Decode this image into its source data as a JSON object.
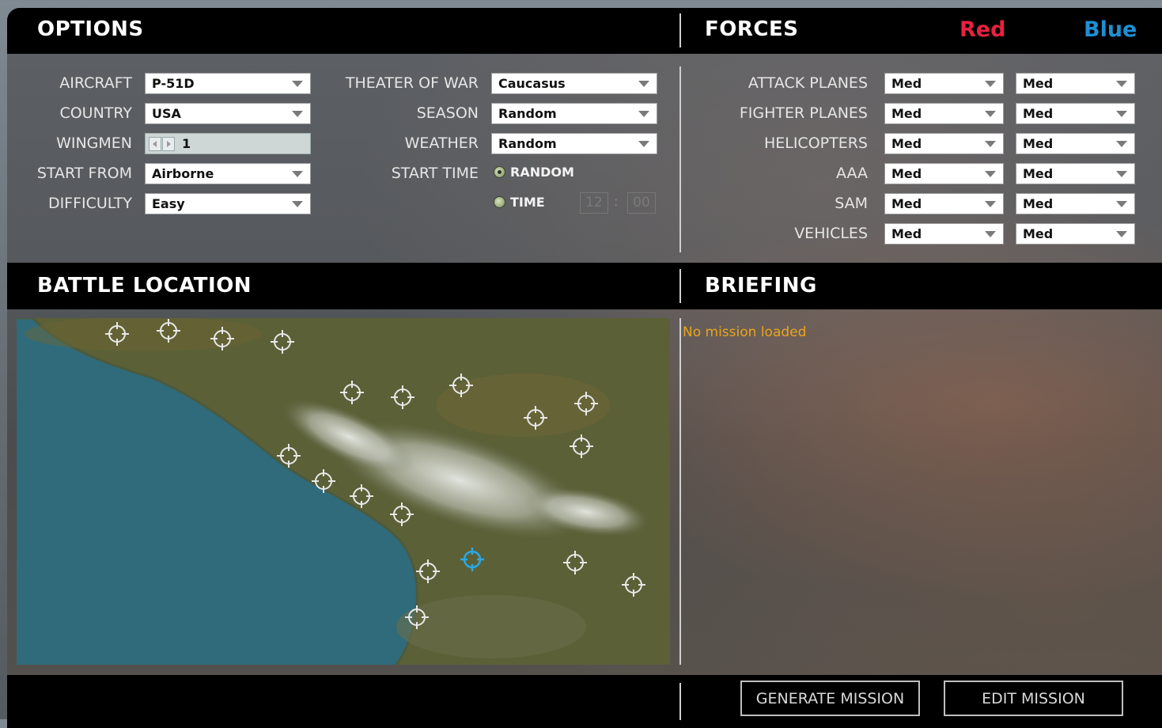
{
  "options": {
    "title": "OPTIONS",
    "aircraft": {
      "label": "AIRCRAFT",
      "value": "P-51D"
    },
    "country": {
      "label": "COUNTRY",
      "value": "USA"
    },
    "wingmen": {
      "label": "WINGMEN",
      "value": "1"
    },
    "start_from": {
      "label": "START FROM",
      "value": "Airborne"
    },
    "difficulty": {
      "label": "DIFFICULTY",
      "value": "Easy"
    },
    "theater": {
      "label": "THEATER OF WAR",
      "value": "Caucasus"
    },
    "season": {
      "label": "SEASON",
      "value": "Random"
    },
    "weather": {
      "label": "WEATHER",
      "value": "Random"
    },
    "start_time": {
      "label": "START TIME",
      "random_label": "RANDOM",
      "time_label": "TIME",
      "selected": "random",
      "hour": "12",
      "separator": ":",
      "minute": "00"
    }
  },
  "forces": {
    "title": "FORCES",
    "red_label": "Red",
    "blue_label": "Blue",
    "red_color": "#e8213f",
    "blue_color": "#1e8fd3",
    "rows": [
      {
        "label": "ATTACK PLANES",
        "red": "Med",
        "blue": "Med"
      },
      {
        "label": "FIGHTER PLANES",
        "red": "Med",
        "blue": "Med"
      },
      {
        "label": "HELICOPTERS",
        "red": "Med",
        "blue": "Med"
      },
      {
        "label": "AAA",
        "red": "Med",
        "blue": "Med"
      },
      {
        "label": "SAM",
        "red": "Med",
        "blue": "Med"
      },
      {
        "label": "VEHICLES",
        "red": "Med",
        "blue": "Med"
      }
    ]
  },
  "battle_location": {
    "title": "BATTLE LOCATION",
    "marker_icon": "crosshair-icon",
    "selected_marker_color": "#29a8e6",
    "marker_color": "#e8e8e8"
  },
  "briefing": {
    "title": "BRIEFING",
    "text": "No mission loaded",
    "text_color": "#e8a51c"
  },
  "buttons": {
    "generate": "GENERATE MISSION",
    "edit": "EDIT MISSION"
  }
}
